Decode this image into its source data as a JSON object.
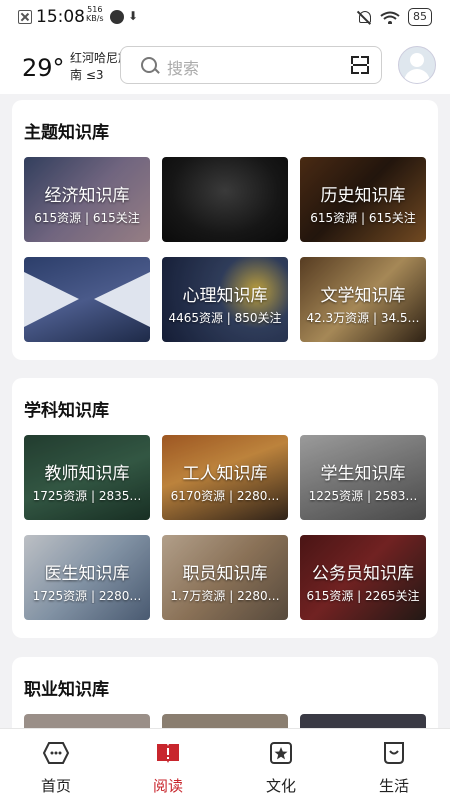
{
  "status_bar": {
    "time": "15:08",
    "net_speed": "516",
    "net_unit": "KB/s",
    "battery": "85"
  },
  "header": {
    "temperature": "29°",
    "location": "红河哈尼族彝族自治州",
    "wind": "南 ≤3",
    "search_placeholder": "搜索"
  },
  "sections": [
    {
      "title": "主题知识库",
      "items": [
        {
          "name": "经济知识库",
          "stats": "615资源 | 615关注"
        },
        {
          "name": "",
          "stats": ""
        },
        {
          "name": "历史知识库",
          "stats": "615资源 | 615关注"
        },
        {
          "name": "",
          "stats": ""
        },
        {
          "name": "心理知识库",
          "stats": "4465资源 | 850关注"
        },
        {
          "name": "文学知识库",
          "stats": "42.3万资源 | 34.5…"
        }
      ]
    },
    {
      "title": "学科知识库",
      "items": [
        {
          "name": "教师知识库",
          "stats": "1725资源 | 2835…"
        },
        {
          "name": "工人知识库",
          "stats": "6170资源 | 2280…"
        },
        {
          "name": "学生知识库",
          "stats": "1225资源 | 2583…"
        },
        {
          "name": "医生知识库",
          "stats": "1725资源 | 2280…"
        },
        {
          "name": "职员知识库",
          "stats": "1.7万资源 | 2280…"
        },
        {
          "name": "公务员知识库",
          "stats": "615资源 | 2265关注"
        }
      ]
    },
    {
      "title": "职业知识库"
    }
  ],
  "tabs": [
    {
      "label": "首页",
      "icon": "home-icon"
    },
    {
      "label": "阅读",
      "icon": "reading-icon",
      "active": true
    },
    {
      "label": "文化",
      "icon": "culture-icon"
    },
    {
      "label": "生活",
      "icon": "life-icon"
    }
  ],
  "colors": {
    "accent": "#c8262d",
    "background": "#f2f2f4"
  }
}
